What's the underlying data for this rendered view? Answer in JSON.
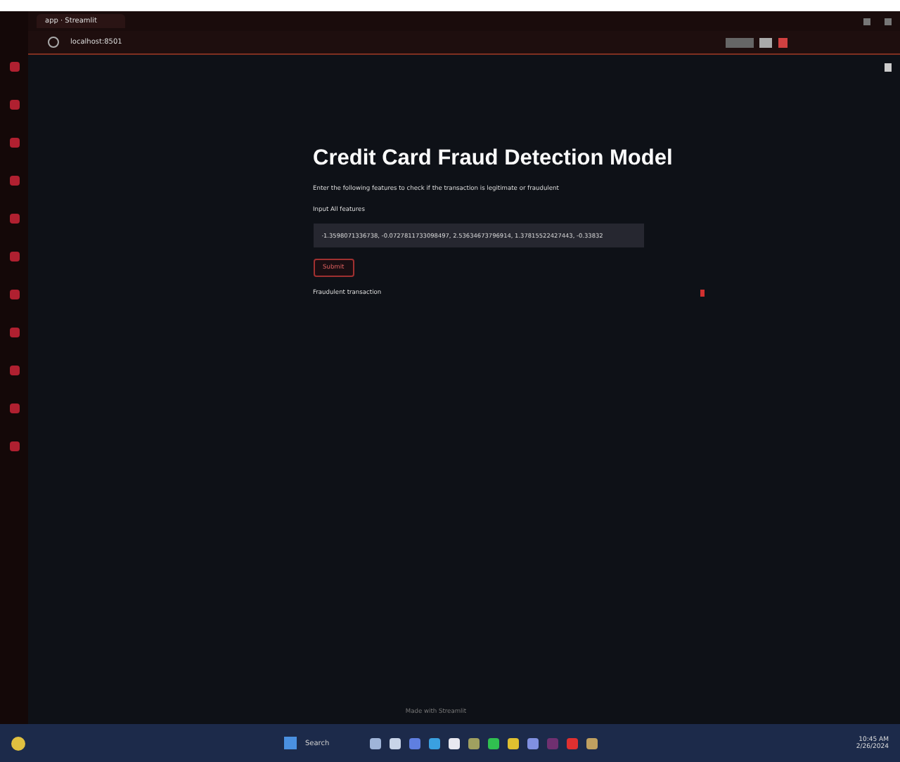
{
  "browser": {
    "tab_title": "app · Streamlit",
    "url": "localhost:8501"
  },
  "page": {
    "title": "Credit Card Fraud Detection Model",
    "description": "Enter the following features to check if the transaction is legitimate or fraudulent",
    "input": {
      "label": "Input All features",
      "value": "-1.3598071336738, -0.0727811733098497, 2.53634673796914, 1.37815522427443, -0.33832"
    },
    "button": "Submit",
    "result": "Fraudulent transaction",
    "footer": "Made with Streamlit"
  },
  "taskbar": {
    "search": "Search",
    "time": "10:45 AM",
    "date": "2/26/2024"
  }
}
